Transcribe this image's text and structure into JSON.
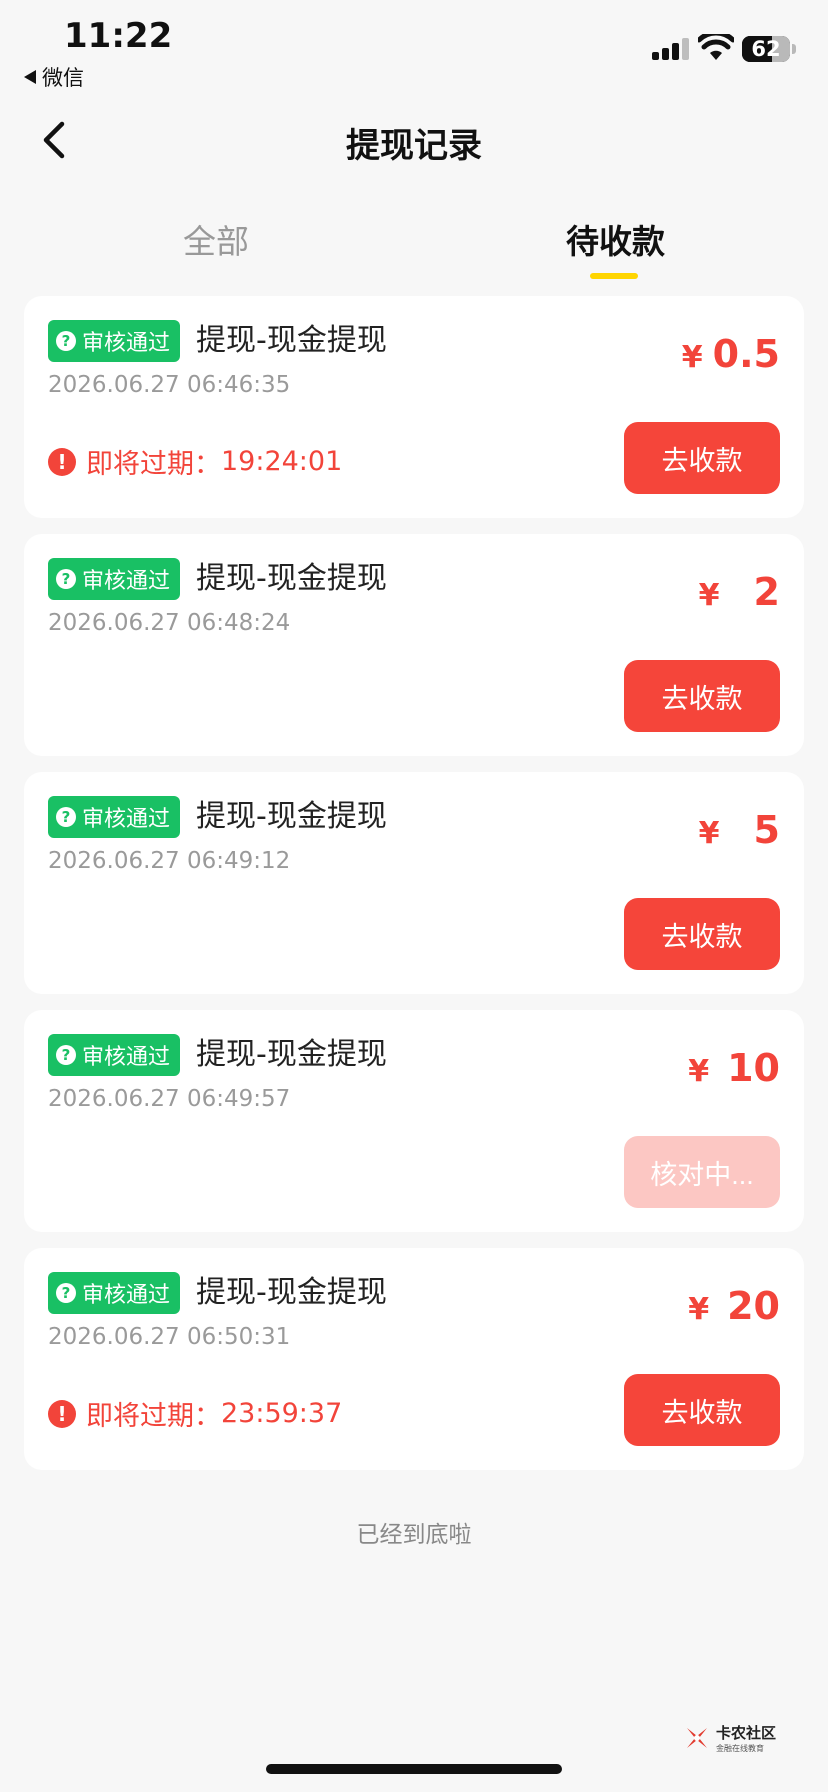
{
  "status_bar": {
    "time": "11:22",
    "back_app": "微信",
    "battery": "62"
  },
  "nav": {
    "title": "提现记录"
  },
  "tabs": [
    {
      "label": "全部",
      "active": false
    },
    {
      "label": "待收款",
      "active": true
    }
  ],
  "records": [
    {
      "badge": "审核通过",
      "title": "提现-现金提现",
      "time": "2026.06.27 06:46:35",
      "currency": "¥",
      "amount": "0.5",
      "expire_label": "即将过期：",
      "expire_time": "19:24:01",
      "button": "去收款",
      "button_disabled": false
    },
    {
      "badge": "审核通过",
      "title": "提现-现金提现",
      "time": "2026.06.27 06:48:24",
      "currency": "¥",
      "amount": "2",
      "expire_label": "",
      "expire_time": "",
      "button": "去收款",
      "button_disabled": false
    },
    {
      "badge": "审核通过",
      "title": "提现-现金提现",
      "time": "2026.06.27 06:49:12",
      "currency": "¥",
      "amount": "5",
      "expire_label": "",
      "expire_time": "",
      "button": "去收款",
      "button_disabled": false
    },
    {
      "badge": "审核通过",
      "title": "提现-现金提现",
      "time": "2026.06.27 06:49:57",
      "currency": "¥",
      "amount": "10",
      "expire_label": "",
      "expire_time": "",
      "button": "核对中...",
      "button_disabled": true
    },
    {
      "badge": "审核通过",
      "title": "提现-现金提现",
      "time": "2026.06.27 06:50:31",
      "currency": "¥",
      "amount": "20",
      "expire_label": "即将过期：",
      "expire_time": "23:59:37",
      "button": "去收款",
      "button_disabled": false
    }
  ],
  "footer": {
    "end_note": "已经到底啦"
  },
  "watermark": {
    "name": "卡农社区",
    "sub": "金融在线教育"
  },
  "colors": {
    "accent_red": "#f5453a",
    "badge_green": "#19c064",
    "tab_underline": "#ffd500"
  }
}
